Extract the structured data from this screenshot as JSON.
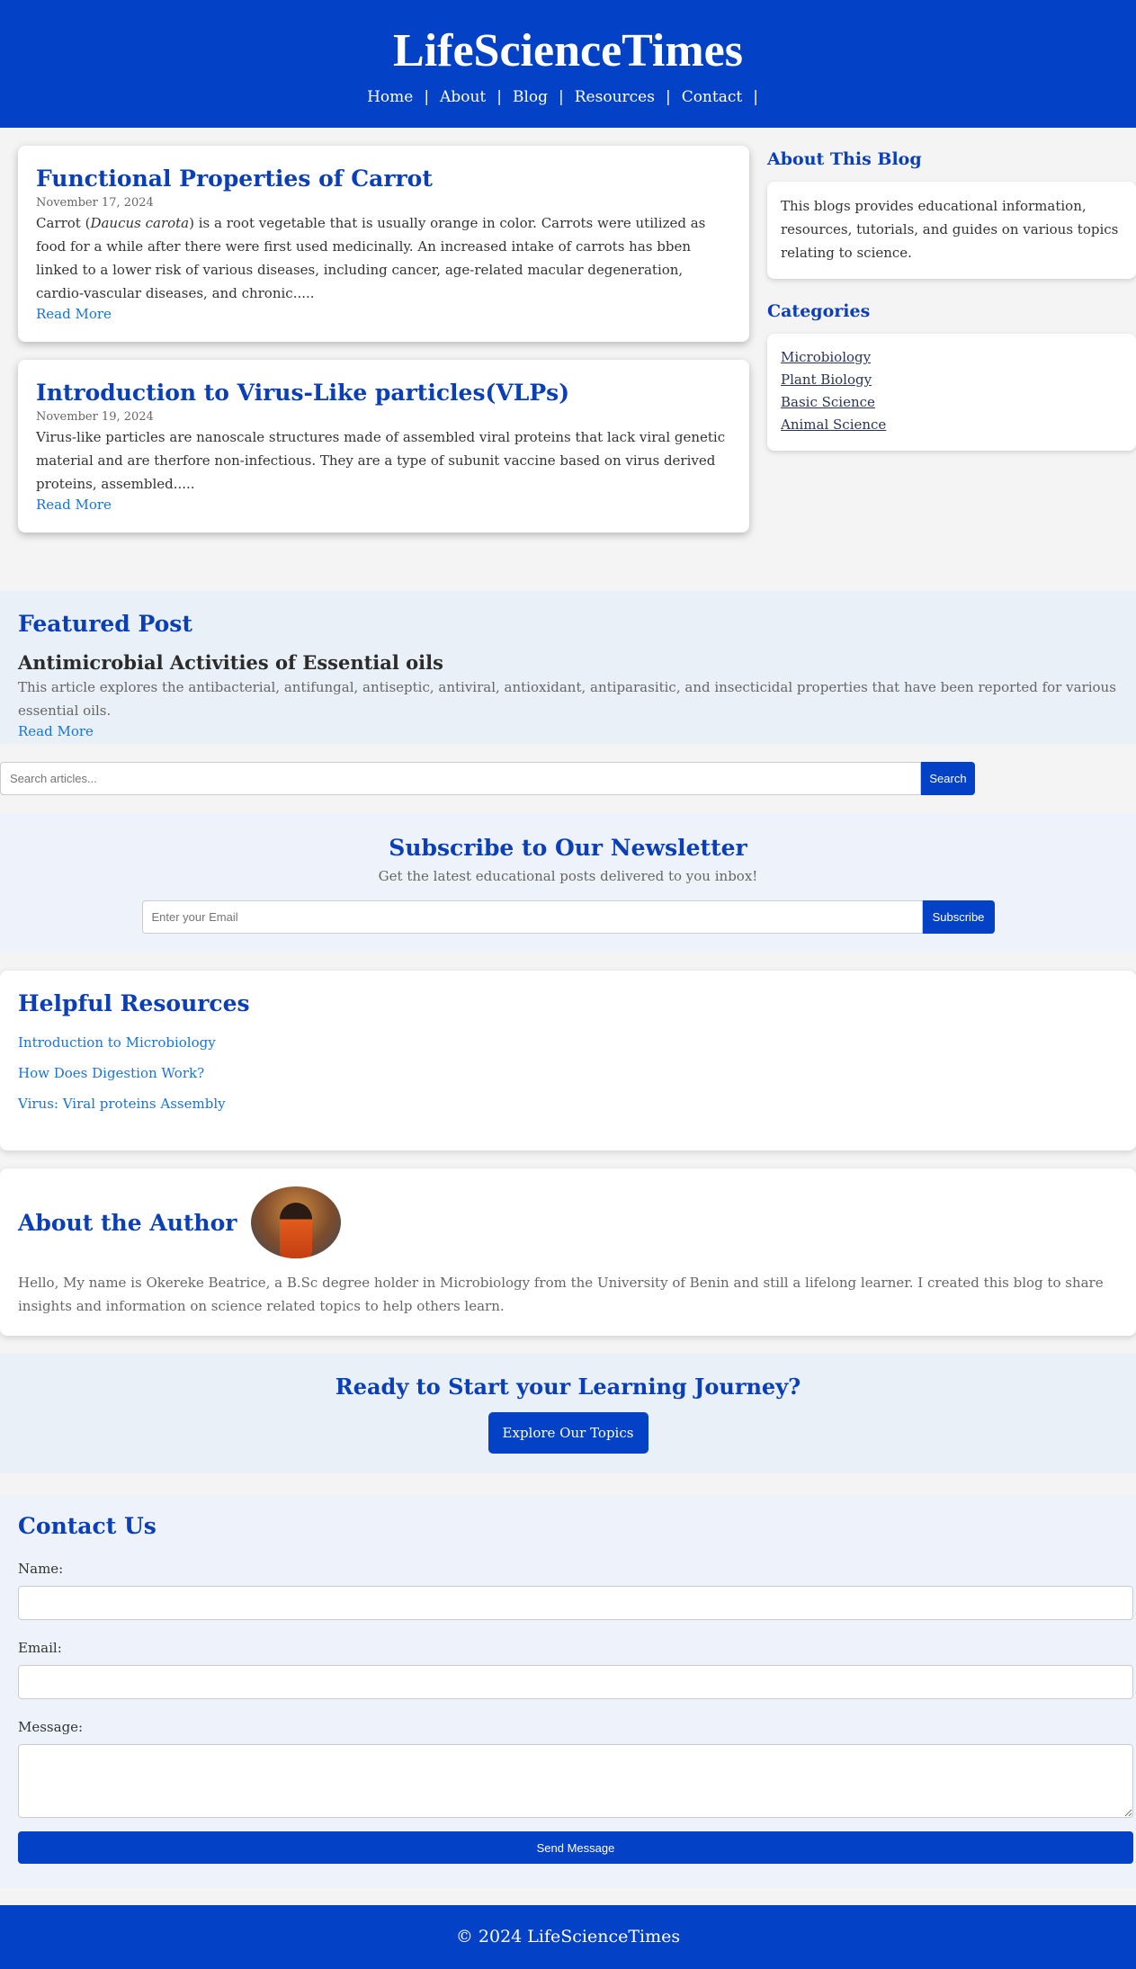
{
  "header": {
    "title": "LifeScienceTimes",
    "nav": [
      "Home",
      "About",
      "Blog",
      "Resources",
      "Contact"
    ],
    "separator": "|"
  },
  "posts": [
    {
      "title": "Functional Properties of Carrot",
      "date": "November 17, 2024",
      "excerpt_before": "Carrot (",
      "excerpt_italic": "Daucus carota",
      "excerpt_after": ") is a root vegetable that is usually orange in color. Carrots were utilized as food for a while after there were first used medicinally. An increased intake of carrots has bben linked to a lower risk of various diseases, including cancer, age-related macular degeneration, cardio-vascular diseases, and chronic.....",
      "read_more": "Read More"
    },
    {
      "title": "Introduction to Virus-Like particles(VLPs)",
      "date": "November 19, 2024",
      "excerpt": "Virus-like particles are nanoscale structures made of assembled viral proteins that lack viral genetic material and are therfore non-infectious. They are a type of subunit vaccine based on virus derived proteins, assembled.....",
      "read_more": "Read More"
    }
  ],
  "sidebar": {
    "about_heading": "About This Blog",
    "about_text": "This blogs provides educational information, resources, tutorials, and guides on various topics relating to science.",
    "categories_heading": "Categories",
    "categories": [
      "Microbiology",
      "Plant Biology",
      "Basic Science",
      "Animal Science"
    ]
  },
  "featured": {
    "heading": "Featured Post",
    "title": "Antimicrobial Activities of Essential oils",
    "text": "This article explores the antibacterial, antifungal, antiseptic, antiviral, antioxidant, antiparasitic, and insecticidal properties that have been reported for various essential oils.",
    "read_more": "Read More"
  },
  "search": {
    "placeholder": "Search articles...",
    "button": "Search"
  },
  "newsletter": {
    "heading": "Subscribe to Our Newsletter",
    "subtext": "Get the latest educational posts delivered to you inbox!",
    "placeholder": "Enter your Email",
    "button": "Subscribe"
  },
  "resources": {
    "heading": "Helpful Resources",
    "links": [
      "Introduction to Microbiology",
      "How Does Digestion Work?",
      "Virus: Viral proteins Assembly"
    ]
  },
  "author": {
    "heading": "About the Author",
    "text": "Hello, My name is Okereke Beatrice, a B.Sc degree holder in Microbiology from the University of Benin and still a lifelong learner. I created this blog to share insights and information on science related topics to help others learn."
  },
  "cta": {
    "heading": "Ready to Start your Learning Journey?",
    "button": "Explore Our Topics"
  },
  "contact": {
    "heading": "Contact Us",
    "name_label": "Name:",
    "email_label": "Email:",
    "message_label": "Message:",
    "button": "Send Message"
  },
  "footer": {
    "text": "© 2024 LifeScienceTimes"
  },
  "colors": {
    "primary": "#0341c6",
    "heading": "#0a3fb8",
    "link": "#1a73d9",
    "page_bg": "#f4f4f4"
  }
}
